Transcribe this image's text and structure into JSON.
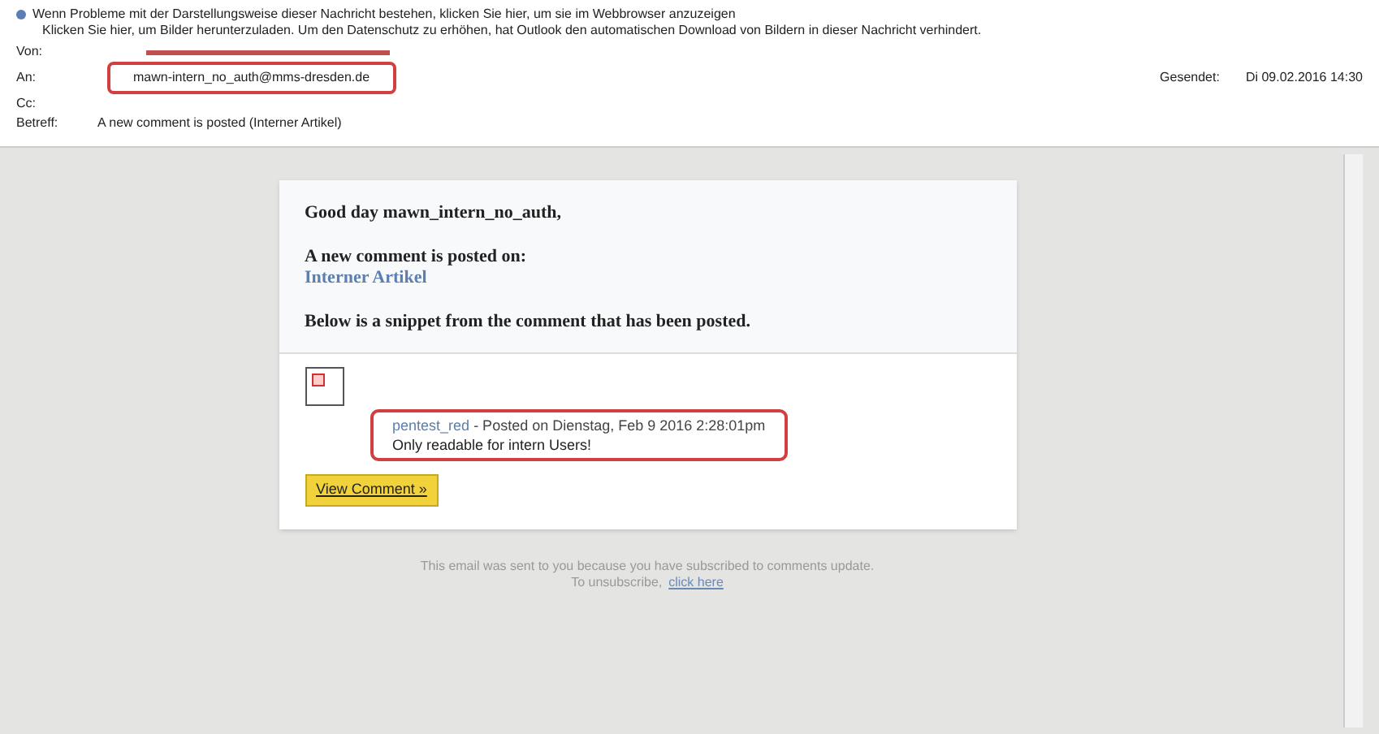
{
  "infobar": {
    "line_1": "Wenn Probleme mit der Darstellungsweise dieser Nachricht bestehen, klicken Sie hier, um sie im Webbrowser anzuzeigen",
    "line_2": "Klicken Sie hier, um Bilder herunterzuladen. Um den Datenschutz zu erhöhen, hat Outlook den automatischen Download von Bildern in dieser Nachricht verhindert."
  },
  "header": {
    "from_label": "Von:",
    "to_label": "An:",
    "to": "mawn-intern_no_auth@mms-dresden.de",
    "cc_label": "Cc:",
    "subject_label": "Betreff:",
    "subject": "A new comment is posted (Interner Artikel)",
    "sent_label": "Gesendet:",
    "sent": "Di 09.02.2016 14:30"
  },
  "message": {
    "greeting": "Good day mawn_intern_no_auth,",
    "intro": "A new comment is posted on:",
    "article_link": "Interner Artikel",
    "snippet_intro": "Below is a snippet from the comment that has been posted.",
    "comment": {
      "author": "pentest_red",
      "posted": "- Posted on Dienstag, Feb 9 2016 2:28:01pm",
      "text": "Only readable for intern Users!"
    },
    "button": "View Comment »",
    "footer_line": "This email was sent to you because you have subscribed to comments update.",
    "unsubscribe": "To unsubscribe,",
    "unsubscribe_link": "click here"
  }
}
